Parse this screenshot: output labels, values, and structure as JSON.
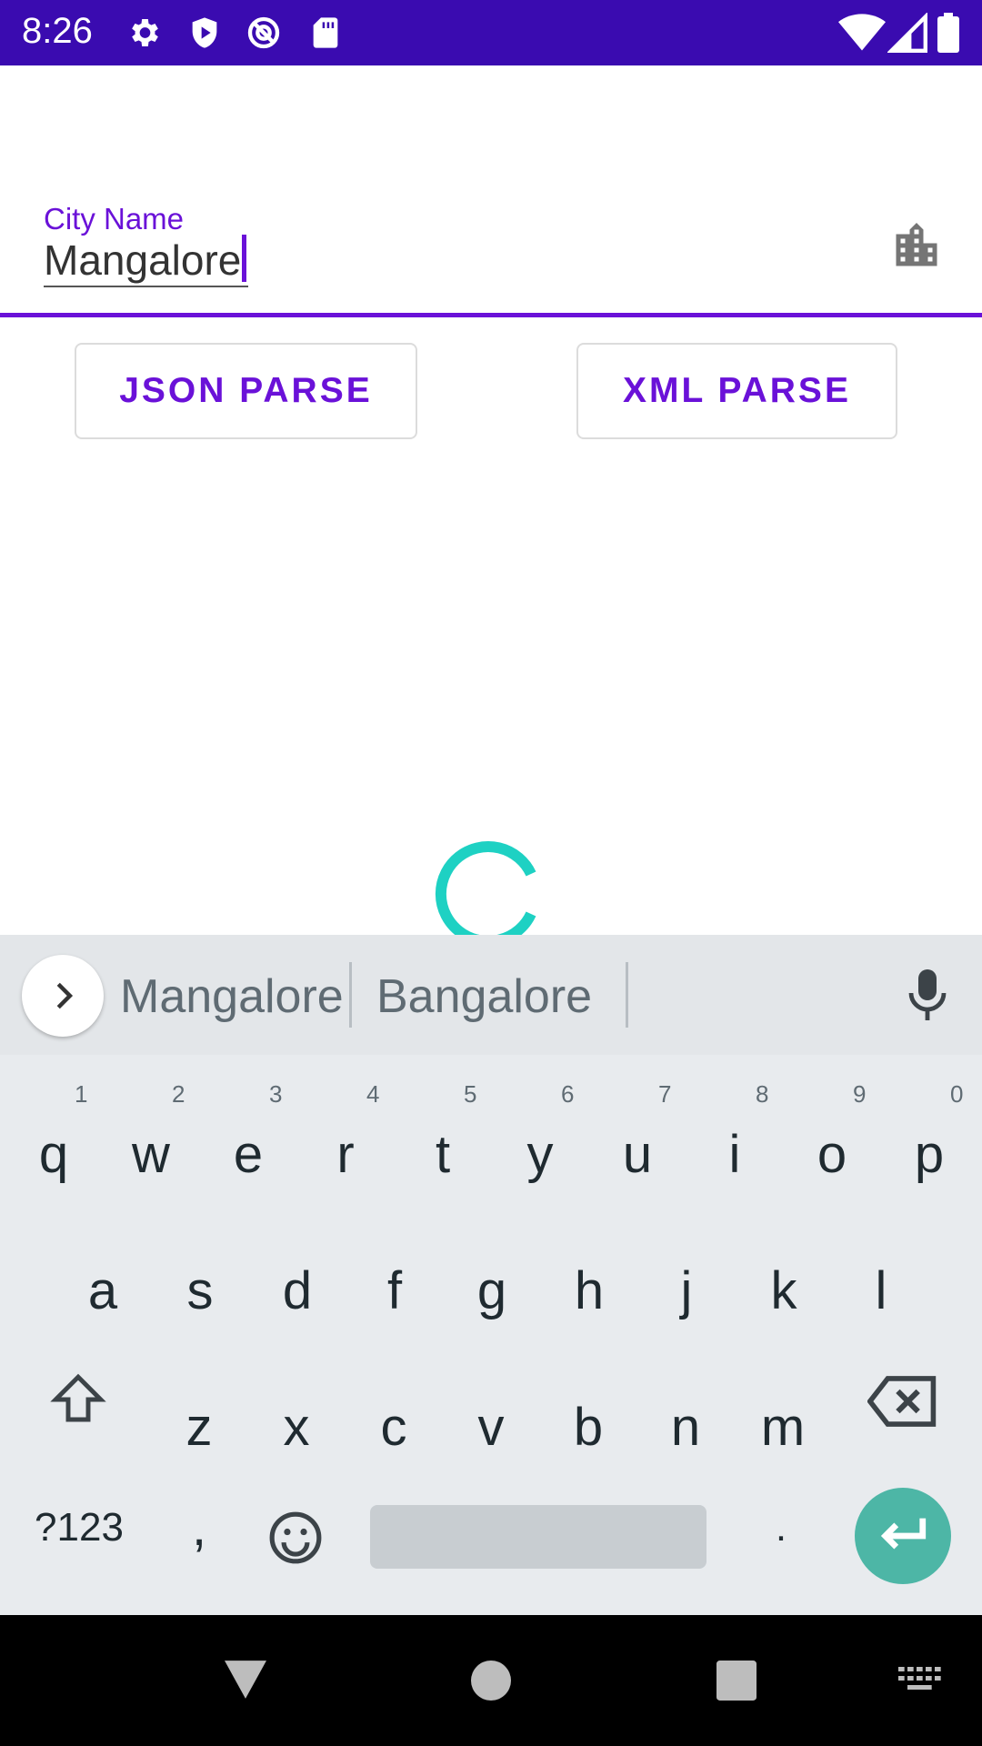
{
  "status_bar": {
    "time": "8:26",
    "left_icons": [
      "settings-icon",
      "play-protect-icon",
      "data-saver-icon",
      "sd-card-icon"
    ],
    "right_icons": [
      "wifi-icon",
      "cell-signal-icon",
      "battery-icon"
    ],
    "background": "#3a0bb0"
  },
  "form": {
    "label": "City Name",
    "value": "Mangalore",
    "end_icon": "city-icon",
    "accent": "#6a11d8"
  },
  "buttons": {
    "json": "JSON PARSE",
    "xml": "XML PARSE"
  },
  "spinner": {
    "color": "#1ed1c3"
  },
  "keyboard": {
    "suggestions": [
      "Mangalore",
      "Bangalore"
    ],
    "row1": [
      "q",
      "w",
      "e",
      "r",
      "t",
      "y",
      "u",
      "i",
      "o",
      "p"
    ],
    "row1_hints": [
      "1",
      "2",
      "3",
      "4",
      "5",
      "6",
      "7",
      "8",
      "9",
      "0"
    ],
    "row2": [
      "a",
      "s",
      "d",
      "f",
      "g",
      "h",
      "j",
      "k",
      "l"
    ],
    "row3": [
      "z",
      "x",
      "c",
      "v",
      "b",
      "n",
      "m"
    ],
    "symbols_label": "?123",
    "comma": ",",
    "period": ".",
    "enter_color": "#4db6a6"
  },
  "nav_bar": {
    "icons": [
      "back-icon",
      "home-icon",
      "recents-icon",
      "keyboard-switch-icon"
    ]
  }
}
